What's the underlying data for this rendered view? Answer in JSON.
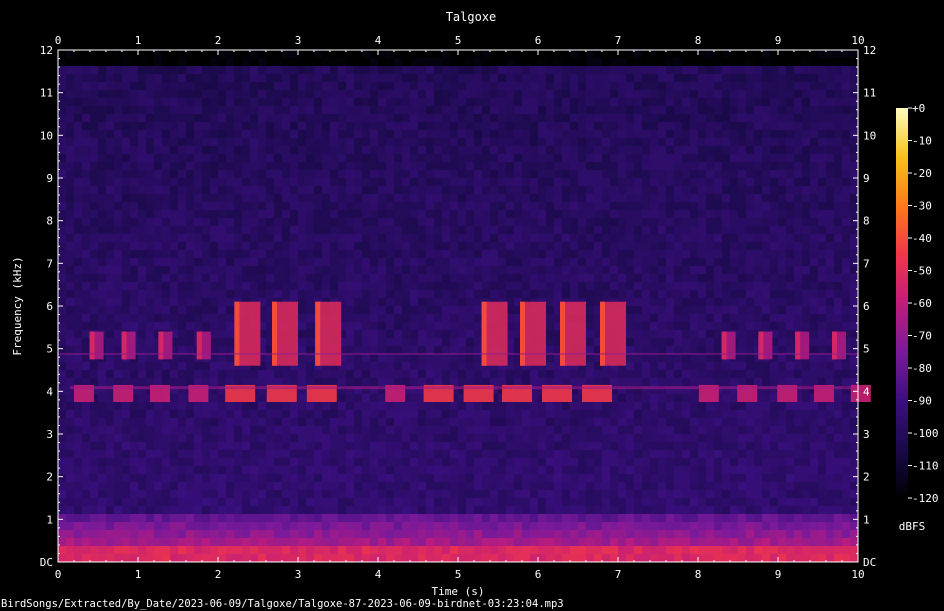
{
  "chart_data": {
    "type": "heatmap",
    "title": "Talgoxe",
    "xlabel": "Time (s)",
    "ylabel": "Frequency (kHz)",
    "xlim": [
      0,
      10
    ],
    "ylim": [
      0,
      12
    ],
    "x_ticks": [
      "0",
      "1",
      "2",
      "3",
      "4",
      "5",
      "6",
      "7",
      "8",
      "9",
      "10"
    ],
    "y_ticks": [
      "DC",
      "1",
      "2",
      "3",
      "4",
      "5",
      "6",
      "7",
      "8",
      "9",
      "10",
      "11",
      "12"
    ],
    "colorbar": {
      "label": "dBFS",
      "range": [
        -120,
        0
      ],
      "ticks": [
        "+0",
        "-10",
        "-20",
        "-30",
        "-40",
        "-50",
        "-60",
        "-70",
        "-80",
        "-90",
        "-100",
        "-110",
        "-120"
      ],
      "colors": [
        "#000000",
        "#1a0a4a",
        "#3b0f80",
        "#7a1a9a",
        "#c01c7a",
        "#f2364a",
        "#fb7a1a",
        "#f8c21a",
        "#fcfcc0"
      ]
    },
    "note_high_5khz": [
      0.42,
      0.82,
      1.28,
      1.76,
      2.23,
      2.7,
      3.24,
      5.32,
      5.8,
      6.3,
      6.8,
      8.32,
      8.78,
      9.24,
      9.7
    ],
    "note_low_4khz": [
      0.25,
      0.74,
      1.2,
      1.68,
      2.14,
      2.66,
      3.16,
      4.14,
      4.62,
      5.12,
      5.6,
      6.1,
      6.6,
      8.06,
      8.54,
      9.04,
      9.5,
      9.96
    ],
    "background_floor_dbfs": -95
  },
  "footer_path": "BirdSongs/Extracted/By_Date/2023-06-09/Talgoxe/Talgoxe-87-2023-06-09-birdnet-03:23:04.mp3"
}
